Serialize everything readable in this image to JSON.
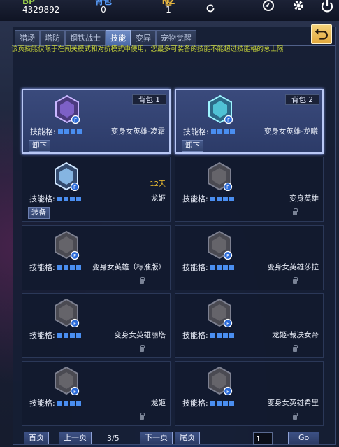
{
  "topbar": {
    "bp_label": "BP",
    "bp_value": "4329892",
    "bag_label": "背包",
    "bag_value": "0",
    "nz_label": "NZ点",
    "nz_value": "1"
  },
  "tabs": [
    {
      "label": "猎场",
      "active": false
    },
    {
      "label": "塔防",
      "active": false
    },
    {
      "label": "钢铁战士",
      "active": false
    },
    {
      "label": "技能",
      "active": true
    },
    {
      "label": "变异",
      "active": false
    },
    {
      "label": "宠物觉醒",
      "active": false
    }
  ],
  "notice": "该页技能仅限于在闯关模式和对抗模式中使用，您最多可装备的技能不能超过技能格的总上限",
  "slot_label": "技能格:",
  "cards": [
    {
      "name": "变身女英雄-凌霜",
      "bag": "背包 1",
      "button": "卸下",
      "selected": true,
      "icon": "female-hero-purple-icon",
      "slots": 4
    },
    {
      "name": "变身女英雄-龙曦",
      "bag": "背包 2",
      "button": "卸下",
      "selected": true,
      "icon": "female-hero-cyan-icon",
      "slots": 4
    },
    {
      "name": "龙姬",
      "timer": "12天",
      "button": "装备",
      "icon": "dragon-princess-icon",
      "slots": 4
    },
    {
      "name": "变身英雄",
      "locked": true,
      "icon": "transform-hero-icon",
      "slots": 4
    },
    {
      "name": "变身女英雄（标准版）",
      "locked": true,
      "icon": "female-hero-standard-icon",
      "slots": 4
    },
    {
      "name": "变身女英雄莎拉",
      "locked": true,
      "icon": "female-hero-sarah-icon",
      "slots": 4
    },
    {
      "name": "变身女英雄丽塔",
      "locked": true,
      "icon": "female-hero-rita-icon",
      "slots": 4
    },
    {
      "name": "龙姬-裁决女帝",
      "locked": true,
      "icon": "dragon-empress-icon",
      "slots": 4
    },
    {
      "name": "龙姬",
      "locked": true,
      "icon": "dragon-princess-locked-icon",
      "slots": 4
    },
    {
      "name": "变身女英雄希里",
      "locked": true,
      "icon": "female-hero-ciri-icon",
      "slots": 4
    }
  ],
  "pager": {
    "first": "首页",
    "prev": "上一页",
    "info": "3/5",
    "next": "下一页",
    "last": "尾页",
    "input_value": "1",
    "go": "Go"
  },
  "colors": {
    "accent": "#4a8ef0",
    "notice": "#c8d43a",
    "timer": "#f0c030"
  }
}
